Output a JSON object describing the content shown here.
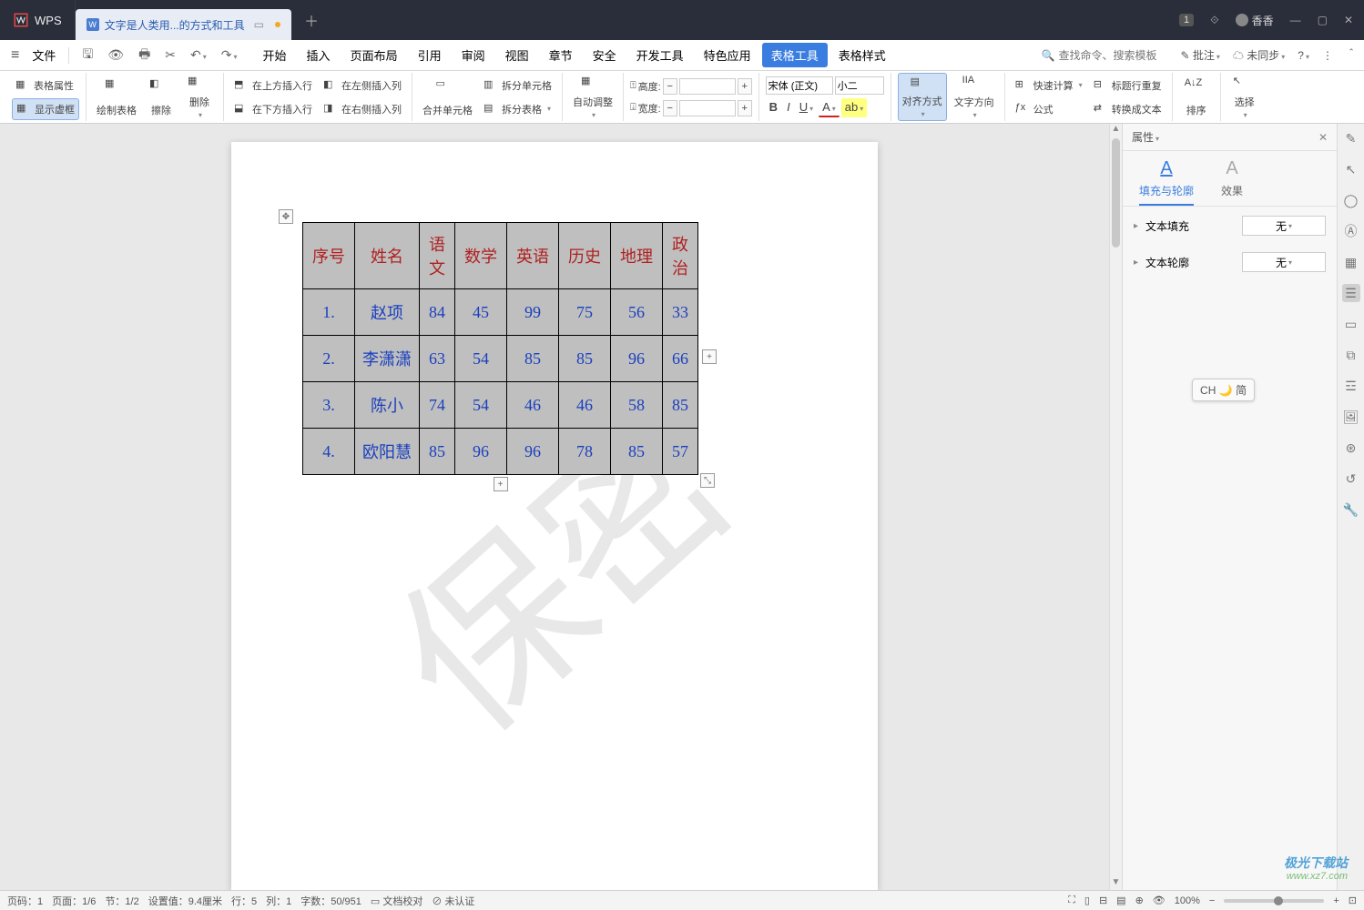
{
  "app_name": "WPS",
  "doc_tab": "文字是人类用...的方式和工具",
  "menu": {
    "file": "文件",
    "items": [
      "开始",
      "插入",
      "页面布局",
      "引用",
      "审阅",
      "视图",
      "章节",
      "安全",
      "开发工具",
      "特色应用",
      "表格工具",
      "表格样式"
    ],
    "active": "表格工具"
  },
  "search_placeholder": "查找命令、搜索模板",
  "topright": {
    "comment": "批注",
    "sync": "未同步",
    "user": "香香",
    "badge": "1"
  },
  "ribbon": {
    "g1a": "表格属性",
    "g1b": "显示虚框",
    "g2a": "绘制表格",
    "g2b": "擦除",
    "g2c": "删除",
    "g3a": "在上方插入行",
    "g3b": "在下方插入行",
    "g3c": "在左侧插入列",
    "g3d": "在右侧插入列",
    "g4a": "合并单元格",
    "g4b": "拆分单元格",
    "g4c": "拆分表格",
    "g5": "自动调整",
    "g6a": "高度:",
    "g6b": "宽度:",
    "font_name": "宋体 (正文)",
    "font_size": "小二",
    "g8a": "对齐方式",
    "g8b": "文字方向",
    "g9a": "快速计算",
    "g9b": "公式",
    "g9c": "标题行重复",
    "g9d": "转换成文本",
    "g10": "排序",
    "g11": "选择"
  },
  "table": {
    "headers": [
      "序号",
      "姓名",
      "语文",
      "数学",
      "英语",
      "历史",
      "地理",
      "政治"
    ],
    "rows": [
      [
        "1.",
        "赵项",
        "84",
        "45",
        "99",
        "75",
        "56",
        "33"
      ],
      [
        "2.",
        "李潇潇",
        "63",
        "54",
        "85",
        "85",
        "96",
        "66"
      ],
      [
        "3.",
        "陈小",
        "74",
        "54",
        "46",
        "46",
        "58",
        "85"
      ],
      [
        "4.",
        "欧阳慧",
        "85",
        "96",
        "96",
        "78",
        "85",
        "57"
      ]
    ]
  },
  "watermark": "保密",
  "ime": "CH 🌙 简",
  "side": {
    "title": "属性",
    "tab1": "填充与轮廓",
    "tab2": "效果",
    "row1": "文本填充",
    "row2": "文本轮廓",
    "none": "无"
  },
  "status": {
    "page_no": "页码：1",
    "page": "页面：1/6",
    "sec": "节：1/2",
    "pos": "设置值：9.4厘米",
    "line": "行：5",
    "col": "列：1",
    "words": "字数：50/951",
    "proof": "文档校对",
    "cert": "未认证",
    "zoom": "100%"
  }
}
